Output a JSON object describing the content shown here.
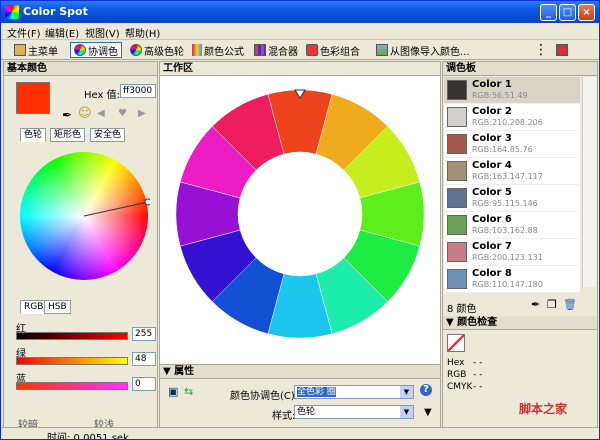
{
  "window": {
    "title": "Color Spot",
    "buttons": {
      "minimize": "_",
      "maximize": "□",
      "close": "×"
    }
  },
  "menu": [
    "文件(F)",
    "编辑(E)",
    "视图(V)",
    "帮助(H)"
  ],
  "toolbar": {
    "items": [
      {
        "label": "主菜单",
        "icon": "menu-icon"
      },
      {
        "label": "协调色",
        "icon": "harmony-icon"
      },
      {
        "label": "高级色轮",
        "icon": "color-wheel-icon"
      },
      {
        "label": "颜色公式",
        "icon": "formula-icon"
      },
      {
        "label": "混合器",
        "icon": "mixer-icon"
      },
      {
        "label": "色彩组合",
        "icon": "combo-icon"
      },
      {
        "label": "从图像导入颜色...",
        "icon": "import-image-icon"
      }
    ]
  },
  "left": {
    "title": "基本颜色",
    "hex_label": "Hex 值:",
    "hex_value": "ff3000",
    "tabs": [
      "色轮",
      "矩形色",
      "安全色"
    ],
    "mode_tabs": [
      "RGB",
      "HSB"
    ],
    "channels": [
      {
        "label": "红",
        "value": "255"
      },
      {
        "label": "绿",
        "value": "48"
      },
      {
        "label": "蓝",
        "value": "0"
      }
    ],
    "bottom": [
      "较暗",
      "较浅"
    ],
    "base_color": "#ff3000"
  },
  "work": {
    "title": "工作区",
    "properties_title": "属性",
    "harmony_label": "颜色协调色(C):",
    "harmony_value": "全色彩 圈",
    "style_label": "样式:",
    "style_value": "色轮"
  },
  "right": {
    "title": "调色板",
    "colors": [
      {
        "name": "Color 1",
        "rgb": "RGB:56.51.49",
        "hex": "#383331"
      },
      {
        "name": "Color 2",
        "rgb": "RGB:210.208.206",
        "hex": "#d2d0ce"
      },
      {
        "name": "Color 3",
        "rgb": "RGB:164.85.76",
        "hex": "#a4554c"
      },
      {
        "name": "Color 4",
        "rgb": "RGB:163.147.117",
        "hex": "#a39375"
      },
      {
        "name": "Color 5",
        "rgb": "RGB:95.115.146",
        "hex": "#5f7392"
      },
      {
        "name": "Color 6",
        "rgb": "RGB:103.162.88",
        "hex": "#67a258"
      },
      {
        "name": "Color 7",
        "rgb": "RGB:200.123.131",
        "hex": "#c87b83"
      },
      {
        "name": "Color 8",
        "rgb": "RGB:110.147.180",
        "hex": "#6e93b4"
      }
    ],
    "count": "8 颜色",
    "check_title": "颜色检查",
    "check_rows": [
      {
        "label": "Hex",
        "value": "- -"
      },
      {
        "label": "RGB",
        "value": "- -"
      },
      {
        "label": "CMYK",
        "value": "- -"
      }
    ]
  },
  "status": {
    "time": "时间: 0.0051 sek"
  },
  "watermark": "脚本之家"
}
